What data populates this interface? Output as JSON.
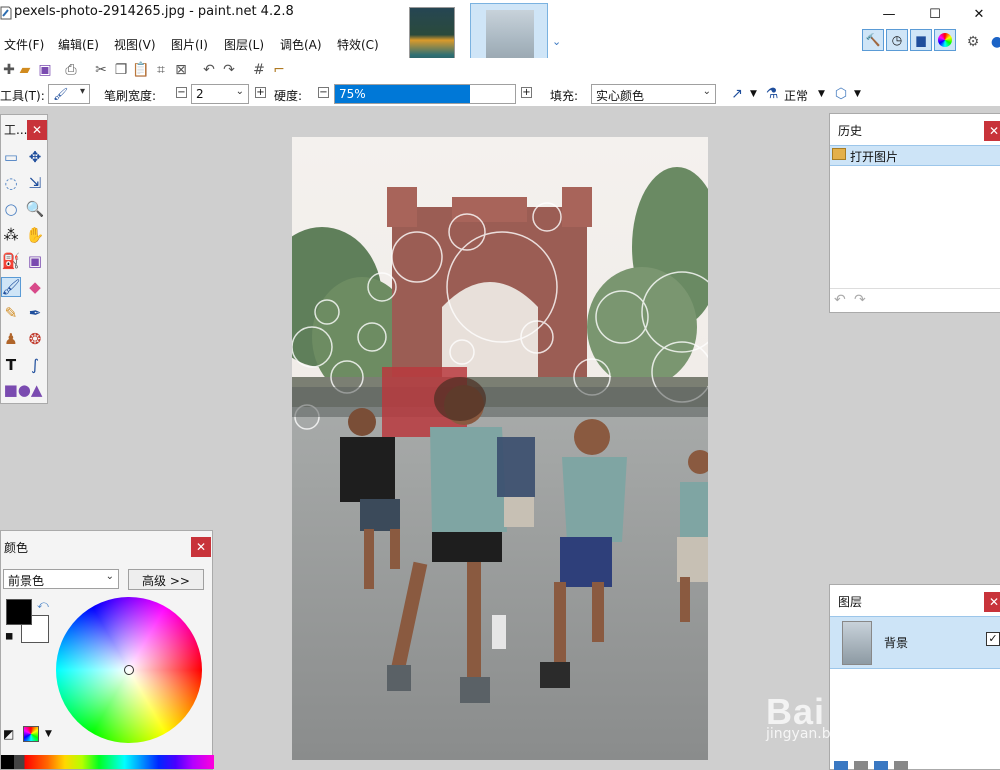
{
  "window": {
    "title": "pexels-photo-2914265.jpg - paint.net 4.2.8"
  },
  "menu": [
    "文件(F)",
    "编辑(E)",
    "视图(V)",
    "图片(I)",
    "图层(L)",
    "调色(A)",
    "特效(C)"
  ],
  "toolbar": {
    "tool_label": "工具(T):",
    "brush_width_label": "笔刷宽度:",
    "brush_width_value": "2",
    "hardness_label": "硬度:",
    "hardness_value": "75%",
    "hardness_level": 0.75,
    "fill_label": "填充:",
    "fill_value": "实心颜色",
    "blend_value": "正常"
  },
  "tools_panel": {
    "title": "工..."
  },
  "history_panel": {
    "title": "历史",
    "items": [
      "打开图片"
    ]
  },
  "colors_panel": {
    "title": "颜色",
    "mode_value": "前景色",
    "advanced_label": "高级 >>",
    "primary_color": "#000000",
    "secondary_color": "#ffffff"
  },
  "layers_panel": {
    "title": "图层",
    "layers": [
      "背景"
    ]
  },
  "watermark": {
    "main": "Bai 经验",
    "sub": "jingyan.baidu.com"
  },
  "colors": {
    "accent": "#0078d7",
    "close": "#c8333a",
    "selection": "#cde4f7"
  }
}
